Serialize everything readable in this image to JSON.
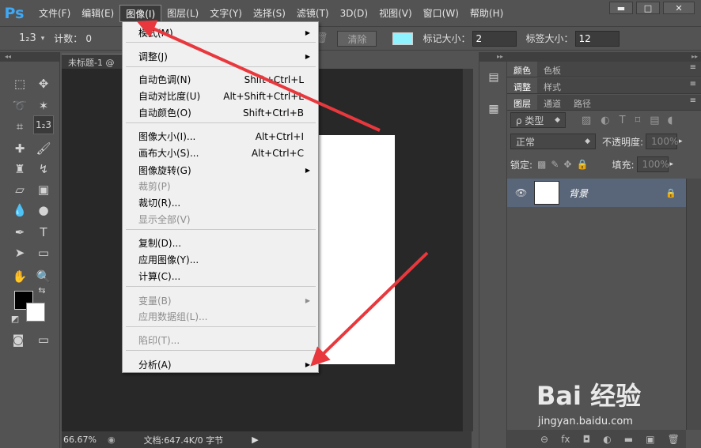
{
  "app": {
    "logo": "Ps"
  },
  "menubar": {
    "items": [
      "文件(F)",
      "编辑(E)",
      "图像(I)",
      "图层(L)",
      "文字(Y)",
      "选择(S)",
      "滤镜(T)",
      "3D(D)",
      "视图(V)",
      "窗口(W)",
      "帮助(H)"
    ],
    "active": "图像(I)"
  },
  "window_controls": {
    "minimize": "▬",
    "maximize": "□",
    "close": "✕"
  },
  "options": {
    "tool_icon": "1₂3",
    "count_label": "计数：",
    "count_value": "0",
    "clear_label": "清除",
    "marker_size_label": "标记大小：",
    "marker_size_value": "2",
    "label_size_label": "标签大小：",
    "label_size_value": "12",
    "marker_color": "#8ff2ff"
  },
  "document": {
    "tab_title": "未标题-1 @",
    "zoom": "66.67%",
    "doc_info": "文档:647.4K/0 字节"
  },
  "image_menu": {
    "items": [
      {
        "label": "模式(M)",
        "shortcut": "",
        "submenu": true,
        "disabled": false
      },
      {
        "label": "调整(J)",
        "shortcut": "",
        "submenu": true,
        "disabled": false
      },
      {
        "label": "自动色调(N)",
        "shortcut": "Shift+Ctrl+L",
        "submenu": false,
        "disabled": false
      },
      {
        "label": "自动对比度(U)",
        "shortcut": "Alt+Shift+Ctrl+L",
        "submenu": false,
        "disabled": false
      },
      {
        "label": "自动颜色(O)",
        "shortcut": "Shift+Ctrl+B",
        "submenu": false,
        "disabled": false
      },
      {
        "label": "图像大小(I)...",
        "shortcut": "Alt+Ctrl+I",
        "submenu": false,
        "disabled": false
      },
      {
        "label": "画布大小(S)...",
        "shortcut": "Alt+Ctrl+C",
        "submenu": false,
        "disabled": false
      },
      {
        "label": "图像旋转(G)",
        "shortcut": "",
        "submenu": true,
        "disabled": false
      },
      {
        "label": "裁剪(P)",
        "shortcut": "",
        "submenu": false,
        "disabled": true
      },
      {
        "label": "裁切(R)...",
        "shortcut": "",
        "submenu": false,
        "disabled": false
      },
      {
        "label": "显示全部(V)",
        "shortcut": "",
        "submenu": false,
        "disabled": true
      },
      {
        "label": "复制(D)...",
        "shortcut": "",
        "submenu": false,
        "disabled": false
      },
      {
        "label": "应用图像(Y)...",
        "shortcut": "",
        "submenu": false,
        "disabled": false
      },
      {
        "label": "计算(C)...",
        "shortcut": "",
        "submenu": false,
        "disabled": false
      },
      {
        "label": "变量(B)",
        "shortcut": "",
        "submenu": true,
        "disabled": true
      },
      {
        "label": "应用数据组(L)...",
        "shortcut": "",
        "submenu": false,
        "disabled": true
      },
      {
        "label": "陷印(T)...",
        "shortcut": "",
        "submenu": false,
        "disabled": true
      },
      {
        "label": "分析(A)",
        "shortcut": "",
        "submenu": true,
        "disabled": false
      }
    ]
  },
  "panels": {
    "top_tabs": [
      [
        "颜色",
        "色板"
      ],
      [
        "调整",
        "样式"
      ]
    ],
    "layer_tabs": [
      "图层",
      "通道",
      "路径"
    ],
    "kind_label": "ρ 类型",
    "blend_mode": "正常",
    "opacity_label": "不透明度:",
    "opacity_value": "100%",
    "lock_label": "锁定:",
    "fill_label": "填充:",
    "fill_value": "100%",
    "layer_name": "背景",
    "bottom_icons": [
      "⊖",
      "fx",
      "◘",
      "◐",
      "▬",
      "▣",
      "🗑"
    ]
  },
  "watermark": {
    "main": "Bai 经验",
    "sub": "jingyan.baidu.com"
  },
  "annotation_color": "#e8383d"
}
